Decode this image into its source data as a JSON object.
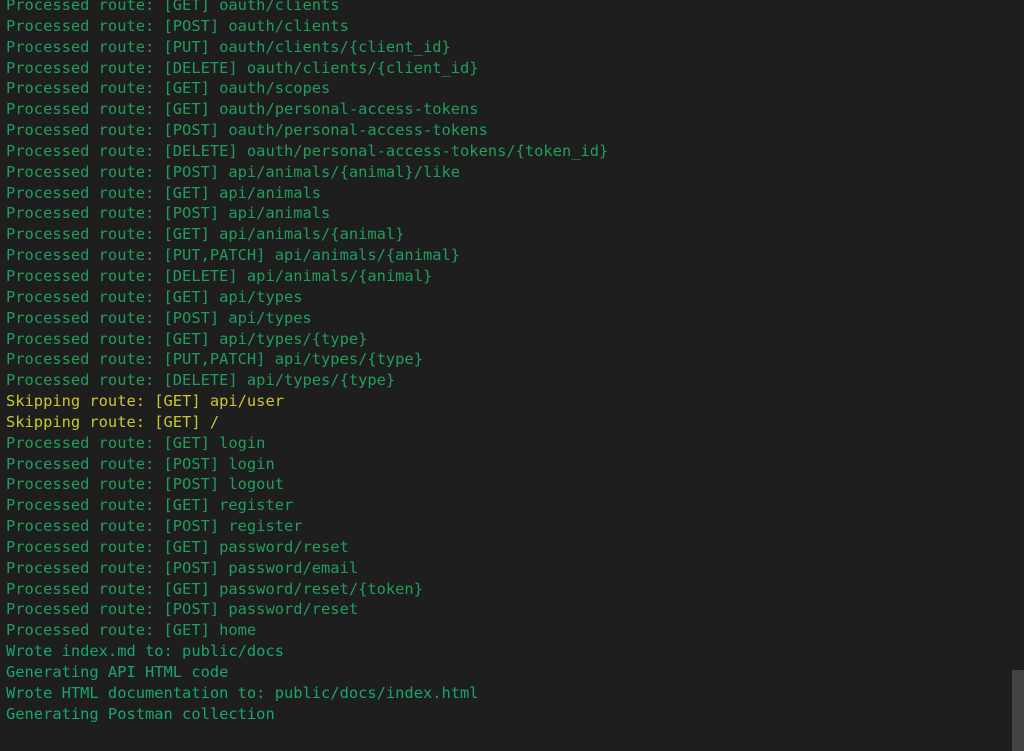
{
  "terminal": {
    "background_color": "#1e1e1e",
    "colors": {
      "processed": "#1f9e5e",
      "skipped": "#c8c82c",
      "wrote": "#16a86a"
    },
    "lines": [
      {
        "text": "Processed route: [GET] oauth/clients",
        "kind": "processed"
      },
      {
        "text": "Processed route: [POST] oauth/clients",
        "kind": "processed"
      },
      {
        "text": "Processed route: [PUT] oauth/clients/{client_id}",
        "kind": "processed"
      },
      {
        "text": "Processed route: [DELETE] oauth/clients/{client_id}",
        "kind": "processed"
      },
      {
        "text": "Processed route: [GET] oauth/scopes",
        "kind": "processed"
      },
      {
        "text": "Processed route: [GET] oauth/personal-access-tokens",
        "kind": "processed"
      },
      {
        "text": "Processed route: [POST] oauth/personal-access-tokens",
        "kind": "processed"
      },
      {
        "text": "Processed route: [DELETE] oauth/personal-access-tokens/{token_id}",
        "kind": "processed"
      },
      {
        "text": "Processed route: [POST] api/animals/{animal}/like",
        "kind": "processed"
      },
      {
        "text": "Processed route: [GET] api/animals",
        "kind": "processed"
      },
      {
        "text": "Processed route: [POST] api/animals",
        "kind": "processed"
      },
      {
        "text": "Processed route: [GET] api/animals/{animal}",
        "kind": "processed"
      },
      {
        "text": "Processed route: [PUT,PATCH] api/animals/{animal}",
        "kind": "processed"
      },
      {
        "text": "Processed route: [DELETE] api/animals/{animal}",
        "kind": "processed"
      },
      {
        "text": "Processed route: [GET] api/types",
        "kind": "processed"
      },
      {
        "text": "Processed route: [POST] api/types",
        "kind": "processed"
      },
      {
        "text": "Processed route: [GET] api/types/{type}",
        "kind": "processed"
      },
      {
        "text": "Processed route: [PUT,PATCH] api/types/{type}",
        "kind": "processed"
      },
      {
        "text": "Processed route: [DELETE] api/types/{type}",
        "kind": "processed"
      },
      {
        "text": "Skipping route: [GET] api/user",
        "kind": "skipped"
      },
      {
        "text": "Skipping route: [GET] /",
        "kind": "skipped"
      },
      {
        "text": "Processed route: [GET] login",
        "kind": "processed"
      },
      {
        "text": "Processed route: [POST] login",
        "kind": "processed"
      },
      {
        "text": "Processed route: [POST] logout",
        "kind": "processed"
      },
      {
        "text": "Processed route: [GET] register",
        "kind": "processed"
      },
      {
        "text": "Processed route: [POST] register",
        "kind": "processed"
      },
      {
        "text": "Processed route: [GET] password/reset",
        "kind": "processed"
      },
      {
        "text": "Processed route: [POST] password/email",
        "kind": "processed"
      },
      {
        "text": "Processed route: [GET] password/reset/{token}",
        "kind": "processed"
      },
      {
        "text": "Processed route: [POST] password/reset",
        "kind": "processed"
      },
      {
        "text": "Processed route: [GET] home",
        "kind": "processed"
      },
      {
        "text": "Wrote index.md to: public/docs",
        "kind": "wrote"
      },
      {
        "text": "Generating API HTML code",
        "kind": "wrote"
      },
      {
        "text": "Wrote HTML documentation to: public/docs/index.html",
        "kind": "wrote"
      },
      {
        "text": "Generating Postman collection",
        "kind": "wrote"
      }
    ]
  },
  "scrollbar": {
    "thumb_color": "#434343",
    "track_color": "#1e1e1e"
  }
}
